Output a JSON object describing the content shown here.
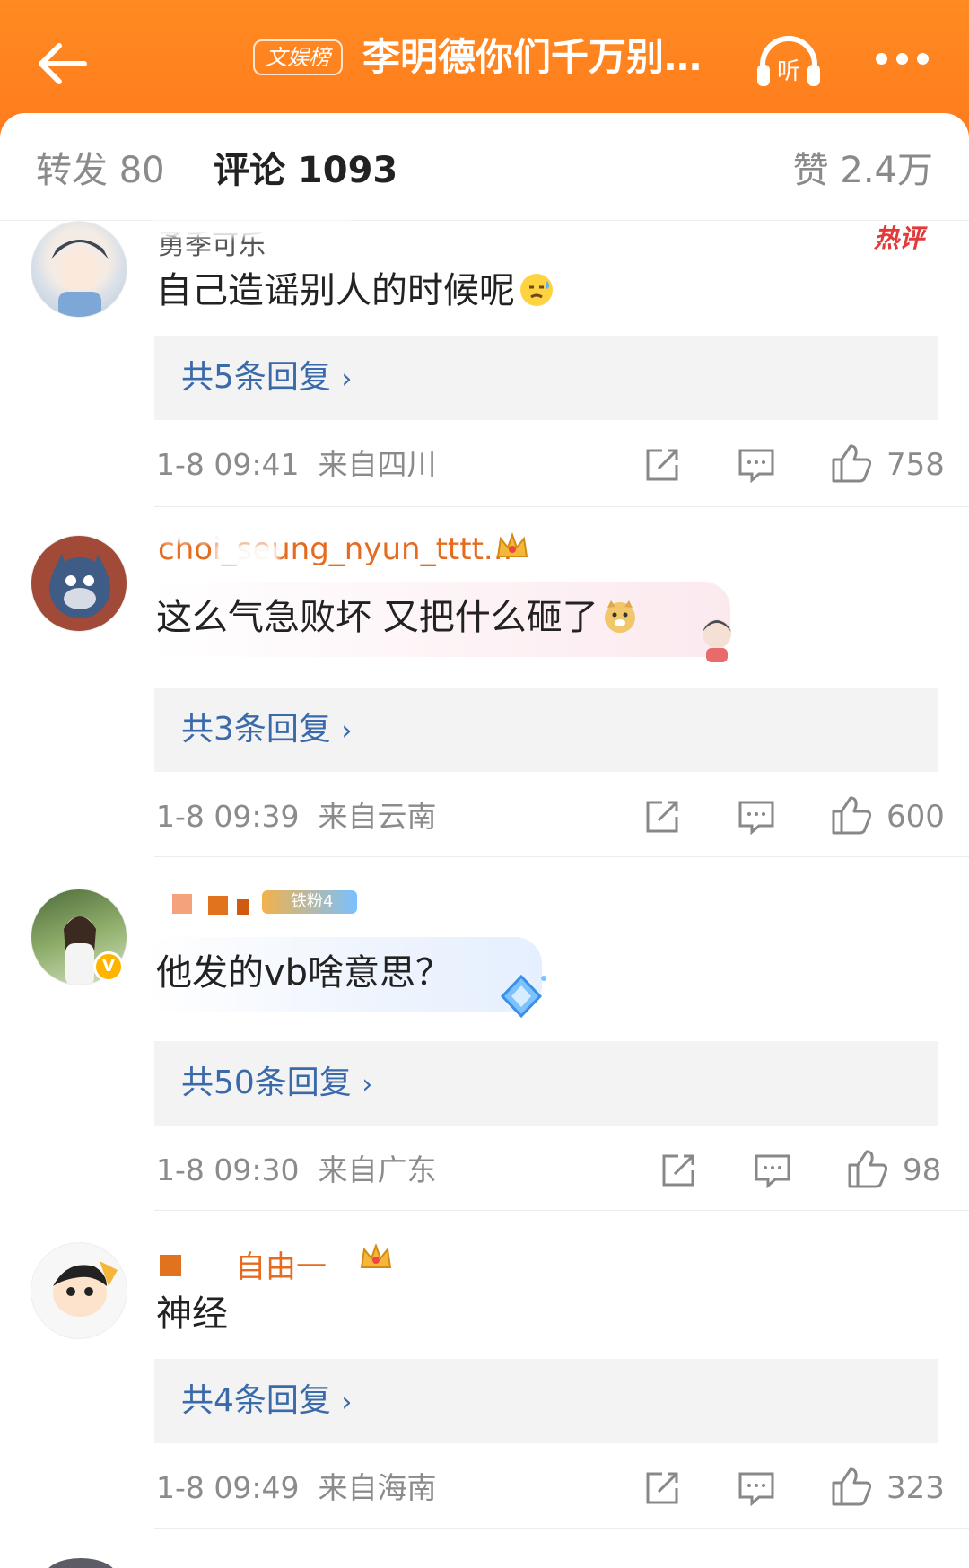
{
  "header": {
    "topic_badge": "文娱榜",
    "title": "李明德你们千万别...",
    "listen_label": "听",
    "back_icon": "arrow-left-icon",
    "more_icon": "more-dots-icon"
  },
  "tabs": {
    "repost": "转发 80",
    "comment": "评论 1093",
    "like": "赞 2.4万"
  },
  "comments": [
    {
      "username": "",
      "username_partial": "勇季可乐",
      "hot_tag": "热评",
      "content": "自己造谣别人的时候呢",
      "replies": "共5条回复",
      "time": "1-8 09:41",
      "location": "来自四川",
      "likes": "758"
    },
    {
      "username_partial": "choi_seung_nyun_tttt...",
      "content": "这么气急败坏 又把什么砸了",
      "replies": "共3条回复",
      "time": "1-8 09:39",
      "location": "来自云南",
      "likes": "600"
    },
    {
      "username_partial": "",
      "badge": "铁粉4",
      "content": "他发的vb啥意思？",
      "replies": "共50条回复",
      "time": "1-8 09:30",
      "location": "来自广东",
      "likes": "98"
    },
    {
      "username_partial": "自由一",
      "content": "神经",
      "replies": "共4条回复",
      "time": "1-8 09:49",
      "location": "来自海南",
      "likes": "323"
    }
  ],
  "colors": {
    "header": "#ff7a1d",
    "username": "#e56b1f",
    "reply_link": "#3a6aaa",
    "hot_tag": "#e23a3a"
  }
}
